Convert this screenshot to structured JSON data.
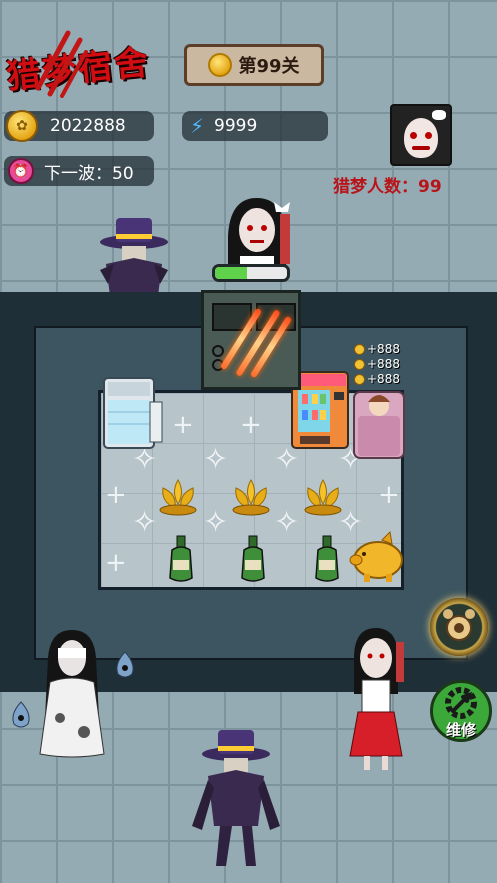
{
  "game_title": "猎梦宿舍",
  "level": {
    "label": "第99关",
    "medal_icon": "gold-medal-icon"
  },
  "coins": {
    "value": "2022888",
    "icon": "coin-icon"
  },
  "energy": {
    "value": "9999",
    "icon": "lightning-icon"
  },
  "wave": {
    "label": "下一波：50",
    "icon": "alarm-clock-icon"
  },
  "hunters": {
    "label": "猎梦人数：99",
    "avatar_icon": "ghost-girl-avatar-icon"
  },
  "door": {
    "hp_fraction": 0.45
  },
  "income_chips": [
    "+888",
    "+888",
    "+888"
  ],
  "repair_button": {
    "label": "维修",
    "icon": "wrench-gear-icon"
  },
  "colors": {
    "title_red": "#d10d12",
    "hp_green": "#5fd14a",
    "repair_green": "#3ca83a"
  }
}
